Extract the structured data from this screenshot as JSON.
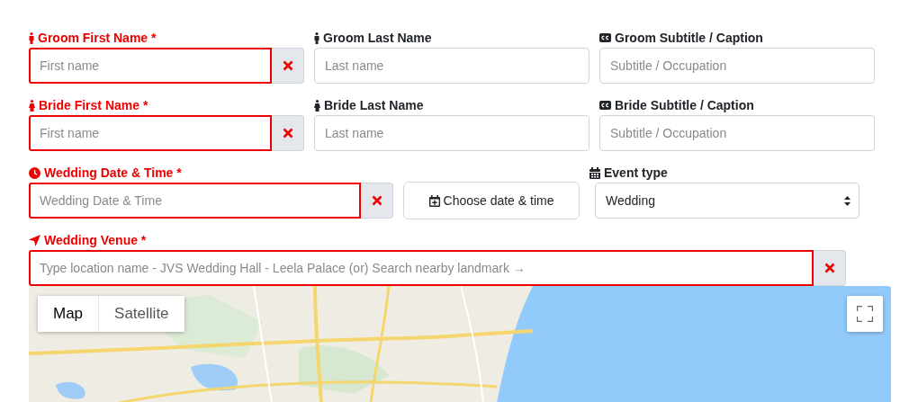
{
  "rows": [
    {
      "items": [
        {
          "kind": "input",
          "label": "Groom First Name *",
          "placeholder": "First name",
          "invalid": true,
          "clear": true
        },
        {
          "kind": "input",
          "label": "Groom Last Name",
          "placeholder": "Last name",
          "invalid": false,
          "clear": false
        },
        {
          "kind": "input",
          "label": "Groom Subtitle / Caption",
          "placeholder": "Subtitle / Occupation",
          "invalid": false,
          "clear": false
        }
      ]
    },
    {
      "items": [
        {
          "kind": "input",
          "label": "Bride First Name *",
          "placeholder": "First name",
          "invalid": true,
          "clear": true
        },
        {
          "kind": "input",
          "label": "Bride Last Name",
          "placeholder": "Last name",
          "invalid": false,
          "clear": false
        },
        {
          "kind": "input",
          "label": "Bride Subtitle / Caption",
          "placeholder": "Subtitle / Occupation",
          "invalid": false,
          "clear": false
        }
      ]
    },
    {
      "items": [
        {
          "kind": "input",
          "label": "Wedding Date & Time *",
          "placeholder": "Wedding Date & Time",
          "invalid": true,
          "clear": true
        },
        {
          "kind": "button",
          "text": "Choose date & time"
        },
        {
          "kind": "select",
          "label": "Event type",
          "value": "Wedding"
        }
      ]
    },
    {
      "items": [
        {
          "kind": "input",
          "label": "Wedding Venue *",
          "placeholder": "Type location name - JVS Wedding Hall - Leela Palace (or) Search nearby landmark →",
          "invalid": true,
          "clear": true
        }
      ]
    }
  ],
  "map": {
    "tabs": [
      {
        "label": "Map",
        "selected": true
      },
      {
        "label": "Satellite",
        "selected": false
      }
    ]
  }
}
